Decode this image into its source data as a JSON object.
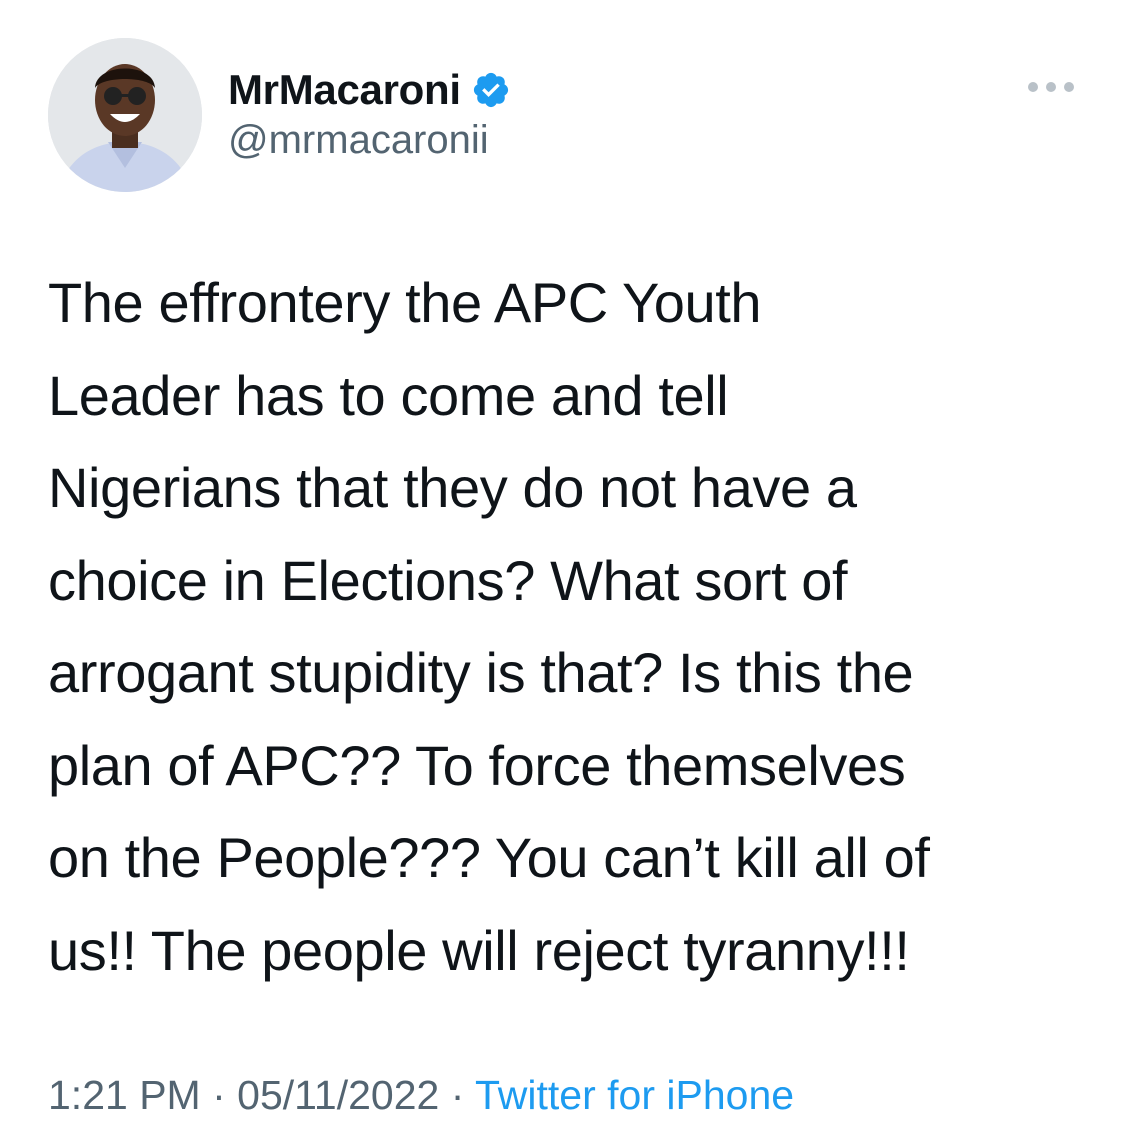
{
  "author": {
    "display_name": "MrMacaroni",
    "handle": "@mrmacaronii",
    "verified": true,
    "avatar_icon": "profile-photo"
  },
  "tweet": {
    "text": "The effrontery the APC Youth\nLeader has to come and tell\nNigerians that they do not have a\nchoice in Elections? What sort of\narrogant stupidity is that? Is this the\nplan of APC?? To force themselves\non the People??? You can’t kill all of\nus!! The people will reject tyranny!!!"
  },
  "meta": {
    "time": "1:21 PM",
    "separator": " · ",
    "date": "05/11/2022",
    "source": "Twitter for iPhone"
  },
  "colors": {
    "verified_badge": "#1d9bf0",
    "source_link": "#1d9bf0",
    "secondary_text": "#536471",
    "primary_text": "#0f1419"
  },
  "icons": {
    "verified": "verified-badge-icon",
    "more": "more-options-icon"
  }
}
